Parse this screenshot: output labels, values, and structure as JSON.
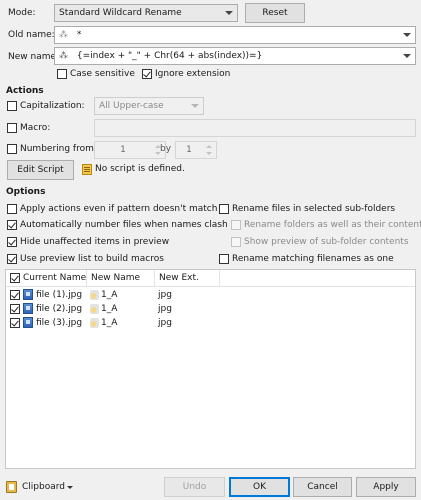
{
  "mode": {
    "label": "Mode:",
    "value": "Standard Wildcard Rename",
    "reset_label": "Reset"
  },
  "old_name": {
    "label": "Old name:",
    "value": "*",
    "prefix": "⁂"
  },
  "new_name": {
    "label": "New name:",
    "value": "{=index + \"_\" + Chr(64 + abs(index))=}",
    "prefix": "⁂"
  },
  "case_sensitive": {
    "label": "Case sensitive",
    "checked": false
  },
  "ignore_extension": {
    "label": "Ignore extension",
    "checked": true
  },
  "actions": {
    "heading": "Actions",
    "capitalization": {
      "label": "Capitalization:",
      "checked": false,
      "value": "All Upper-case"
    },
    "macro": {
      "label": "Macro:",
      "checked": false,
      "value": ""
    },
    "numbering": {
      "label": "Numbering from:",
      "checked": false,
      "from": "1",
      "by_label": "by",
      "by": "1"
    },
    "edit_script_label": "Edit Script",
    "script_status": "No script is defined."
  },
  "options": {
    "heading": "Options",
    "left": [
      {
        "label": "Apply actions even if pattern doesn't match",
        "checked": false
      },
      {
        "label": "Automatically number files when names clash",
        "checked": true
      },
      {
        "label": "Hide unaffected items in preview",
        "checked": true
      },
      {
        "label": "Use preview list to build macros",
        "checked": true
      }
    ],
    "right": [
      {
        "label": "Rename files in selected sub-folders",
        "checked": false,
        "disabled": false
      },
      {
        "label": "Rename folders as well as their contents",
        "checked": false,
        "disabled": true
      },
      {
        "label": "Show preview of sub-folder contents",
        "checked": false,
        "disabled": true
      },
      {
        "label": "Rename matching filenames as one",
        "checked": false,
        "disabled": false
      }
    ]
  },
  "preview": {
    "columns": [
      "Current Name",
      "New Name",
      "New Ext."
    ],
    "rows": [
      {
        "current": "file (1).jpg",
        "new_name": "1_A",
        "ext": "jpg",
        "checked": true
      },
      {
        "current": "file (2).jpg",
        "new_name": "1_A",
        "ext": "jpg",
        "checked": true
      },
      {
        "current": "file (3).jpg",
        "new_name": "1_A",
        "ext": "jpg",
        "checked": true
      }
    ]
  },
  "footer": {
    "clipboard": "Clipboard",
    "undo": "Undo",
    "ok": "OK",
    "cancel": "Cancel",
    "apply": "Apply"
  }
}
